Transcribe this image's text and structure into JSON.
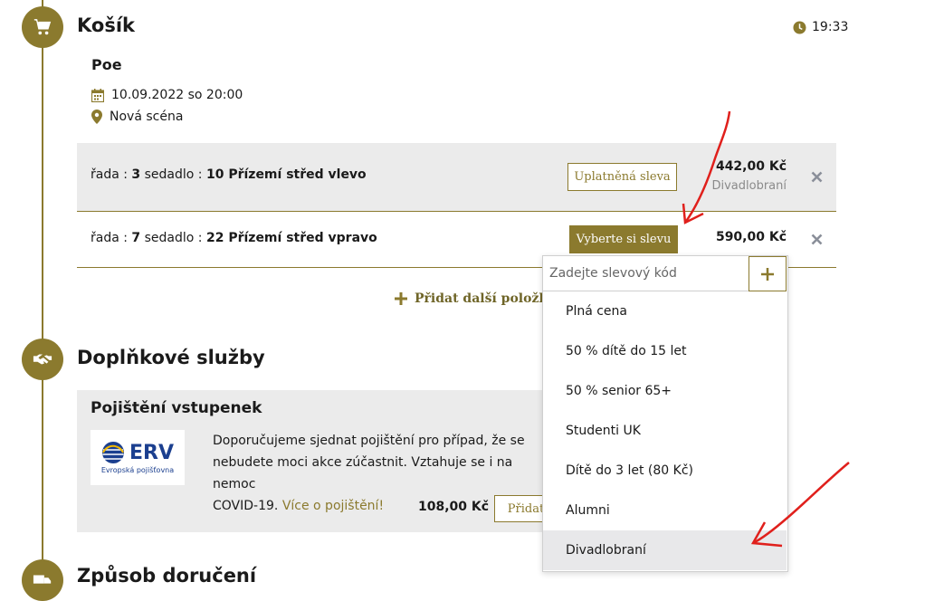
{
  "colors": {
    "accent": "#8b7a2e",
    "row_grey": "#ebebeb",
    "annotation_red": "#e0201c"
  },
  "cart": {
    "heading": "Košík",
    "timer": "19:33",
    "event_title": "Poe",
    "event_date": "10.09.2022 so 20:00",
    "venue": "Nová scéna",
    "items": [
      {
        "row_label": "řada : ",
        "row_num": "3",
        "seat_label": " sedadlo : ",
        "seat_num": "10 Přízemí střed vlevo",
        "discount_button": "Uplatněná sleva",
        "price": "442,00 Kč",
        "discount_name": "Divadlobraní"
      },
      {
        "row_label": "řada : ",
        "row_num": "7",
        "seat_label": " sedadlo : ",
        "seat_num": "22 Přízemí střed vpravo",
        "discount_button": "Vyberte si slevu",
        "price": "590,00 Kč"
      }
    ],
    "add_more": "Přidat další položky"
  },
  "discount_dropdown": {
    "code_placeholder": "Zadejte slevový kód",
    "options": [
      "Plná cena",
      "50 % dítě do 15 let",
      "50 % senior 65+",
      "Studenti UK",
      "Dítě do 3 let (80 Kč)",
      "Alumni",
      "Divadlobraní"
    ],
    "selected": "Divadlobraní"
  },
  "extras": {
    "heading": "Doplňkové služby",
    "insurance_title": "Pojištění vstupenek",
    "logo_text": "ERV",
    "logo_subtext": "Evropská pojišťovna",
    "description_line1": "Doporučujeme sjednat pojištění pro případ, že se",
    "description_line2": "nebudete moci akce zúčastnit. Vztahuje se i na nemoc",
    "description_line3": "COVID-19. ",
    "more_link": "Více o pojištění!",
    "price": "108,00 Kč",
    "add_button": "Přidat"
  },
  "delivery": {
    "heading": "Způsob doručení"
  },
  "icons": [
    "cart-icon",
    "clock-icon",
    "calendar-icon",
    "location-pin-icon",
    "close-icon",
    "plus-icon",
    "handshake-icon",
    "truck-icon"
  ]
}
